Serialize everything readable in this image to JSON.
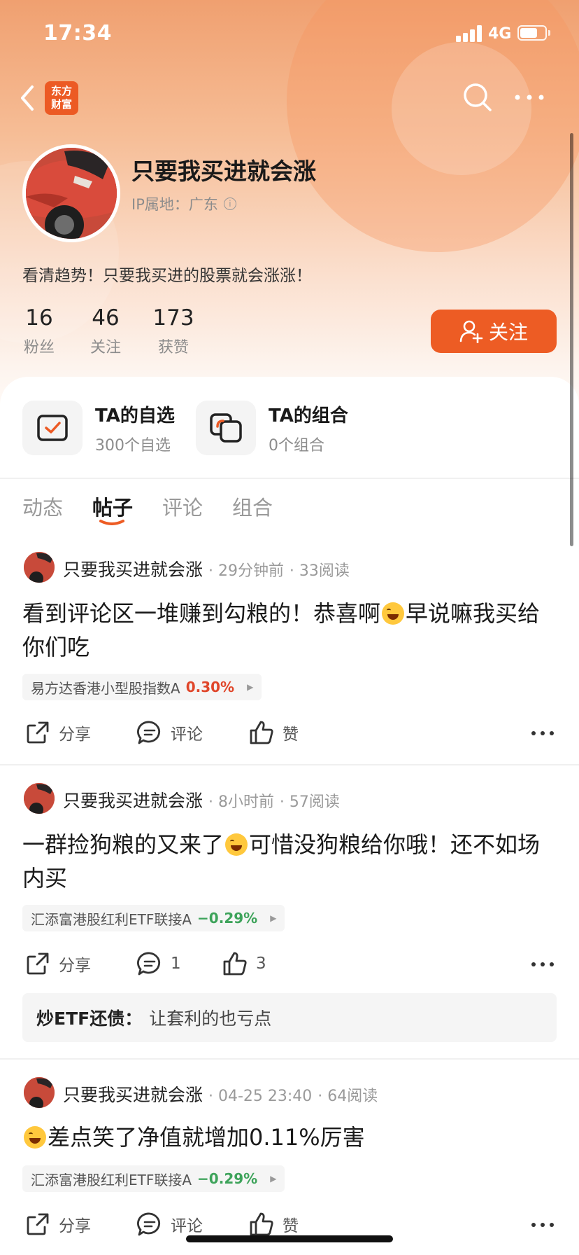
{
  "status_bar": {
    "time": "17:34",
    "network": "4G"
  },
  "nav": {
    "logo_line1": "东方",
    "logo_line2": "财富"
  },
  "profile": {
    "username": "只要我买进就会涨",
    "ip_location": "IP属地：广东",
    "bio": "看清趋势！只要我买进的股票就会涨涨！",
    "stats": [
      {
        "value": "16",
        "label": "粉丝"
      },
      {
        "value": "46",
        "label": "关注"
      },
      {
        "value": "173",
        "label": "获赞"
      }
    ],
    "follow_label": "关注"
  },
  "shortcuts": [
    {
      "title": "TA的自选",
      "subtitle": "300个自选"
    },
    {
      "title": "TA的组合",
      "subtitle": "0个组合"
    }
  ],
  "tabs": [
    {
      "label": "动态",
      "active": false
    },
    {
      "label": "帖子",
      "active": true
    },
    {
      "label": "评论",
      "active": false
    },
    {
      "label": "组合",
      "active": false
    }
  ],
  "posts": [
    {
      "author": "只要我买进就会涨",
      "time": "29分钟前",
      "reads": "33阅读",
      "text_a": "看到评论区一堆赚到勾粮的！恭喜啊",
      "text_b": "早说嘛我买给你们吃",
      "tag_name": "易方达香港小型股指数A",
      "tag_pct": "0.30%",
      "share": "分享",
      "comment": "评论",
      "like": "赞"
    },
    {
      "author": "只要我买进就会涨",
      "time": "8小时前",
      "reads": "57阅读",
      "text_a": "一群捡狗粮的又来了",
      "text_b": "可惜没狗粮给你哦！还不如场内买",
      "tag_name": "汇添富港股红利ETF联接A",
      "tag_pct": "−0.29%",
      "share": "分享",
      "comment": "1",
      "like": "3",
      "comment_preview": {
        "user": "炒ETF还债：",
        "text": "让套利的也亏点"
      }
    },
    {
      "author": "只要我买进就会涨",
      "time": "04-25 23:40",
      "reads": "64阅读",
      "text_b": "差点笑了净值就增加0.11%厉害",
      "tag_name": "汇添富港股红利ETF联接A",
      "tag_pct": "−0.29%",
      "share": "分享",
      "comment": "评论",
      "like": "赞"
    }
  ],
  "colors": {
    "brand": "#ed5c24",
    "up": "#e0462a",
    "down": "#3da35a"
  }
}
